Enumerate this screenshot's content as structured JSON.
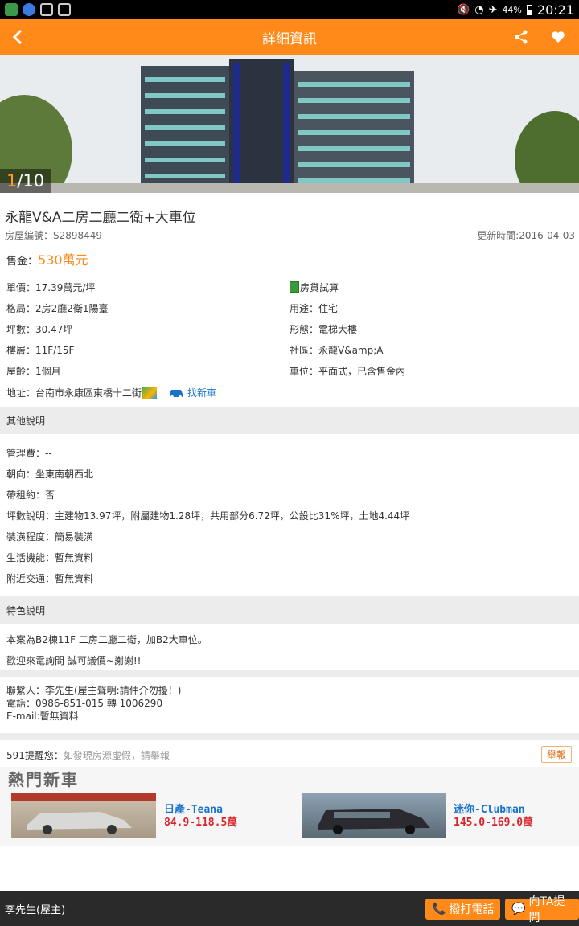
{
  "status": {
    "battery": "44%",
    "time": "20:21"
  },
  "nav": {
    "title": "詳細資訊"
  },
  "hero": {
    "current": "1",
    "total": "/10"
  },
  "listing": {
    "title": "永龍V&A二房二廳二衛+大車位",
    "id": "房屋編號：S2898449",
    "updated": "更新時間:2016-04-03",
    "price_label": "售金：",
    "price_value": "530萬元",
    "left": [
      "單價：17.39萬元/坪",
      "格局：2房2廳2衛1陽臺",
      "坪數：30.47坪",
      "樓層：11F/15F",
      "屋齡：1個月"
    ],
    "right": [
      "房貸試算",
      "用途：住宅",
      "形態：電梯大樓",
      "社區：永龍V&amp;A",
      "車位：平面式，已含售金內"
    ],
    "address": "地址：台南市永康區東橋十二街",
    "find_car": "找新車"
  },
  "other": {
    "header": "其他說明",
    "items": [
      "管理費：--",
      "朝向：坐東南朝西北",
      "帶租約：否",
      "坪數說明：主建物13.97坪，附屬建物1.28坪，共用部分6.72坪，公設比31%坪，土地4.44坪",
      "裝潢程度：簡易裝潢",
      "生活機能：暫無資料",
      "附近交通：暫無資料"
    ]
  },
  "feature": {
    "header": "特色說明",
    "line1": "本案為B2棟11F 二房二廳二衛，加B2大車位。",
    "line2": "歡迎來電詢問 誠可議價~謝謝!!"
  },
  "contact": {
    "person": "聯繫人：李先生(屋主聲明:請仲介勿擾！)",
    "phone": "電話：0986-851-015 轉 1006290",
    "email": "E-mail:暫無資料"
  },
  "warning": {
    "prefix": "591提醒您：",
    "text": "如發現房源虛假，請舉報",
    "report": "舉報"
  },
  "ad": {
    "title": "熱門新車",
    "cars": [
      {
        "name": "日產-Teana",
        "price": "84.9-118.5萬"
      },
      {
        "name": "迷你-Clubman",
        "price": "145.0-169.0萬"
      }
    ]
  },
  "bottom": {
    "owner": "李先生(屋主)",
    "call": "撥打電話",
    "ask": "向TA提問"
  },
  "colors": {
    "accent": "#ff8a1a",
    "link": "#1a73c9"
  }
}
